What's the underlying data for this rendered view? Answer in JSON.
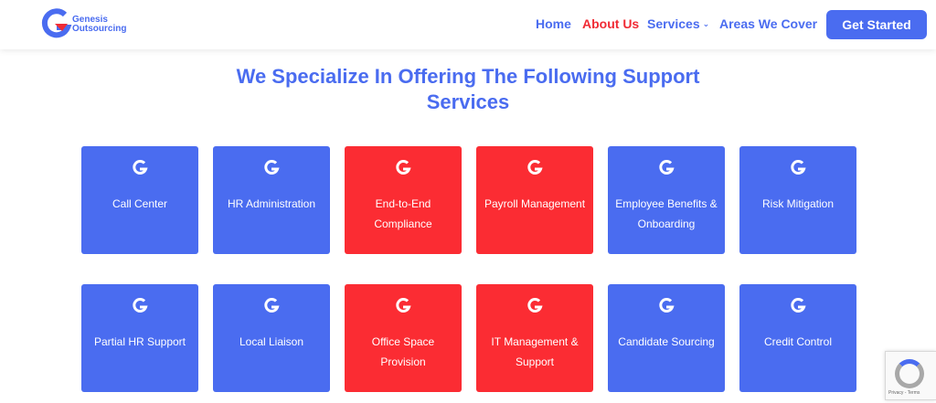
{
  "brand": {
    "name_line1": "Genesis",
    "name_line2": "Outsourcing",
    "logo_letter": "G"
  },
  "nav": {
    "home": "Home",
    "about": "About Us",
    "services": "Services",
    "areas": "Areas We Cover"
  },
  "cta_label": "Get Started",
  "heading": {
    "line1": "We Specialize In Offering The Following Support",
    "line2": "Services"
  },
  "colors": {
    "accent": "#4a6cf0",
    "red": "#fb2c33"
  },
  "services": [
    {
      "label": "Call Center",
      "color": "blue"
    },
    {
      "label": "HR Administration",
      "color": "blue"
    },
    {
      "label": "End-to-End Compliance",
      "color": "red"
    },
    {
      "label": "Payroll Management",
      "color": "red"
    },
    {
      "label": "Employee Benefits & Onboarding",
      "color": "blue"
    },
    {
      "label": "Risk Mitigation",
      "color": "blue"
    },
    {
      "label": "Partial HR Support",
      "color": "blue"
    },
    {
      "label": "Local Liaison",
      "color": "blue"
    },
    {
      "label": "Office Space Provision",
      "color": "red"
    },
    {
      "label": "IT Management & Support",
      "color": "red"
    },
    {
      "label": "Candidate Sourcing",
      "color": "blue"
    },
    {
      "label": "Credit Control",
      "color": "blue"
    }
  ],
  "recaptcha": {
    "text": "Privacy - Terms"
  }
}
